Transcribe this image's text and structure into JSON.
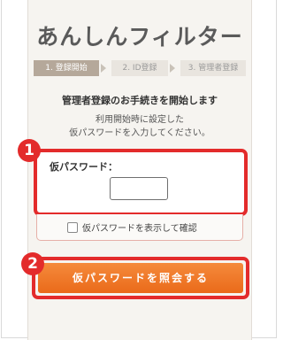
{
  "app_title": "あんしんフィルター",
  "steps": [
    {
      "label": "1. 登録開始",
      "active": true
    },
    {
      "label": "2. ID登録",
      "active": false
    },
    {
      "label": "3. 管理者登録",
      "active": false
    }
  ],
  "intro": {
    "heading": "管理者登録のお手続きを開始します",
    "line1": "利用開始時に設定した",
    "line2": "仮パスワードを入力してください。"
  },
  "password": {
    "label": "仮パスワード：",
    "value": "",
    "show_label": "仮パスワードを表示して確認",
    "show_checked": false
  },
  "submit_label": "仮パスワードを照会する",
  "badges": {
    "one": "1",
    "two": "2"
  },
  "colors": {
    "highlight": "#e32b2b",
    "button": "#f07c2a",
    "step_active": "#b5a89a"
  }
}
